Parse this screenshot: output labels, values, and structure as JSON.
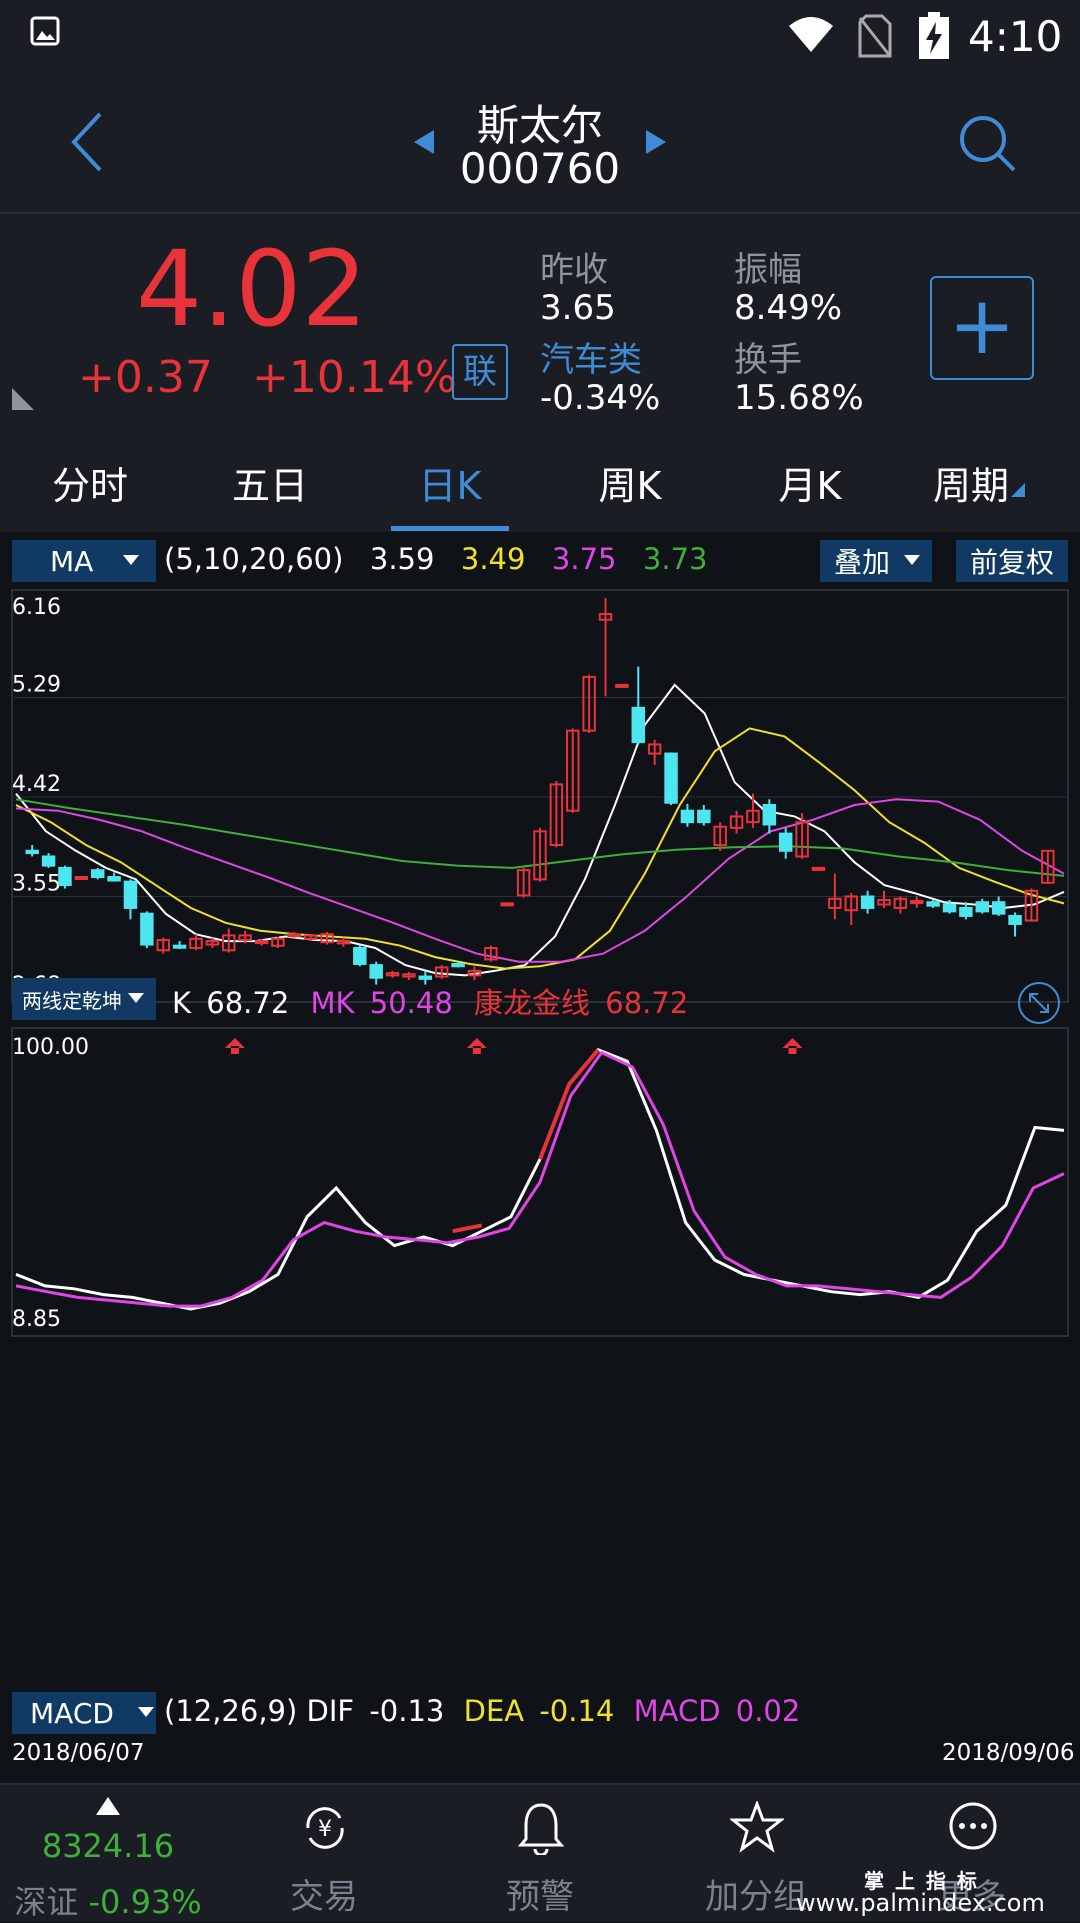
{
  "status": {
    "time": "4:10"
  },
  "header": {
    "name": "斯太尔",
    "code": "000760"
  },
  "quote": {
    "price": "4.02",
    "change": "+0.37",
    "change_pct": "+10.14%",
    "lian_badge": "联",
    "prev_close_label": "昨收",
    "prev_close": "3.65",
    "amplitude_label": "振幅",
    "amplitude": "8.49%",
    "sector_label": "汽车类",
    "sector_change": "-0.34%",
    "turnover_label": "换手",
    "turnover": "15.68%",
    "add_button": "+"
  },
  "tabs": [
    "分时",
    "五日",
    "日K",
    "周K",
    "月K",
    "周期"
  ],
  "ma_bar": {
    "selector": "MA",
    "params": "(5,10,20,60)",
    "v1": "3.59",
    "v2": "3.49",
    "v3": "3.75",
    "v4": "3.73",
    "overlay": "叠加",
    "adjust": "前复权"
  },
  "indicator_bar": {
    "selector": "两线定乾坤",
    "k_label": "K",
    "k_value": "68.72",
    "mk_label": "MK",
    "mk_value": "50.48",
    "klgx_label": "康龙金线",
    "klgx_value": "68.72"
  },
  "macd_bar": {
    "selector": "MACD",
    "params": "(12,26,9)",
    "dif_label": "DIF",
    "dif": "-0.13",
    "dea_label": "DEA",
    "dea": "-0.14",
    "macd_label": "MACD",
    "macd": "0.02"
  },
  "dates": {
    "start": "2018/06/07",
    "end": "2018/09/06"
  },
  "nav": {
    "index_value": "8324.16",
    "index_name": "深证",
    "index_change": "-0.93%",
    "trade": "交易",
    "alert": "预警",
    "watch": "加分组",
    "more": "更多",
    "watermark": "掌 上 指 标",
    "watermark_url": "www.palmindex.com"
  },
  "colors": {
    "up": "#e8333a",
    "down": "#4de6f0",
    "accent": "#3f8bd6",
    "ma5": "#ffffff",
    "ma10": "#f0e12a",
    "ma20": "#e046e6",
    "ma60": "#3fae3a"
  },
  "chart_data": [
    {
      "type": "candlestick",
      "title": "",
      "ylim": [
        2.68,
        6.16
      ],
      "ytick_labels": [
        "6.16",
        "5.29",
        "4.42",
        "3.55",
        "2.68"
      ],
      "ohlc": [
        [
          3.95,
          4.0,
          3.9,
          3.93
        ],
        [
          3.9,
          3.93,
          3.8,
          3.82
        ],
        [
          3.8,
          3.82,
          3.62,
          3.65
        ],
        [
          3.72,
          3.73,
          3.72,
          3.72
        ],
        [
          3.78,
          3.8,
          3.7,
          3.72
        ],
        [
          3.72,
          3.76,
          3.68,
          3.69
        ],
        [
          3.68,
          3.7,
          3.35,
          3.45
        ],
        [
          3.4,
          3.42,
          3.1,
          3.13
        ],
        [
          3.08,
          3.19,
          3.05,
          3.17
        ],
        [
          3.12,
          3.16,
          3.09,
          3.11
        ],
        [
          3.1,
          3.22,
          3.08,
          3.18
        ],
        [
          3.13,
          3.19,
          3.1,
          3.16
        ],
        [
          3.08,
          3.27,
          3.06,
          3.21
        ],
        [
          3.17,
          3.25,
          3.14,
          3.21
        ],
        [
          3.15,
          3.18,
          3.12,
          3.16
        ],
        [
          3.12,
          3.2,
          3.1,
          3.18
        ],
        [
          3.21,
          3.24,
          3.19,
          3.22
        ],
        [
          3.18,
          3.22,
          3.16,
          3.21
        ],
        [
          3.15,
          3.24,
          3.13,
          3.22
        ],
        [
          3.14,
          3.19,
          3.11,
          3.16
        ],
        [
          3.1,
          3.13,
          2.94,
          2.96
        ],
        [
          2.95,
          2.98,
          2.78,
          2.84
        ],
        [
          2.86,
          2.9,
          2.84,
          2.88
        ],
        [
          2.85,
          2.89,
          2.82,
          2.87
        ],
        [
          2.85,
          2.9,
          2.78,
          2.83
        ],
        [
          2.85,
          2.95,
          2.83,
          2.93
        ],
        [
          2.96,
          2.98,
          2.93,
          2.94
        ],
        [
          2.86,
          2.94,
          2.82,
          2.9
        ],
        [
          3.0,
          3.12,
          2.98,
          3.1
        ],
        [
          3.48,
          3.5,
          3.48,
          3.49
        ],
        [
          3.56,
          3.8,
          3.54,
          3.78
        ],
        [
          3.7,
          4.15,
          3.68,
          4.12
        ],
        [
          4.0,
          4.56,
          3.98,
          4.53
        ],
        [
          4.3,
          5.02,
          4.28,
          5.0
        ],
        [
          5.0,
          5.49,
          4.98,
          5.47
        ],
        [
          5.97,
          6.16,
          5.3,
          6.02
        ],
        [
          5.4,
          5.4,
          5.39,
          5.4
        ],
        [
          5.2,
          5.56,
          4.88,
          4.9
        ],
        [
          4.8,
          4.92,
          4.7,
          4.88
        ],
        [
          4.8,
          4.81,
          4.35,
          4.37
        ],
        [
          4.3,
          4.36,
          4.16,
          4.2
        ],
        [
          4.3,
          4.35,
          4.17,
          4.2
        ],
        [
          4.0,
          4.2,
          3.95,
          4.16
        ],
        [
          4.15,
          4.3,
          4.1,
          4.25
        ],
        [
          4.2,
          4.45,
          4.15,
          4.3
        ],
        [
          4.35,
          4.4,
          4.1,
          4.18
        ],
        [
          4.1,
          4.15,
          3.88,
          3.95
        ],
        [
          3.9,
          4.28,
          3.88,
          4.2
        ],
        [
          3.8,
          3.8,
          3.8,
          3.8
        ],
        [
          3.45,
          3.75,
          3.35,
          3.53
        ],
        [
          3.43,
          3.58,
          3.3,
          3.55
        ],
        [
          3.55,
          3.6,
          3.4,
          3.45
        ],
        [
          3.48,
          3.6,
          3.45,
          3.52
        ],
        [
          3.45,
          3.55,
          3.4,
          3.53
        ],
        [
          3.5,
          3.55,
          3.45,
          3.51
        ],
        [
          3.5,
          3.52,
          3.45,
          3.47
        ],
        [
          3.48,
          3.52,
          3.4,
          3.42
        ],
        [
          3.45,
          3.5,
          3.35,
          3.38
        ],
        [
          3.5,
          3.53,
          3.4,
          3.42
        ],
        [
          3.5,
          3.55,
          3.38,
          3.4
        ],
        [
          3.38,
          3.41,
          3.2,
          3.31
        ],
        [
          3.34,
          3.62,
          3.33,
          3.6
        ],
        [
          3.67,
          3.95,
          3.66,
          3.95
        ]
      ],
      "series": [
        {
          "name": "MA5",
          "values": [
            4.45,
            4.12,
            3.95,
            3.8,
            3.7,
            3.4,
            3.22,
            3.16,
            3.16,
            3.2,
            3.17,
            3.16,
            3.1,
            2.95,
            2.88,
            2.86,
            2.9,
            2.95,
            3.2,
            3.7,
            4.35,
            5.05,
            5.4,
            5.15,
            4.55,
            4.3,
            4.25,
            4.12,
            3.85,
            3.65,
            3.58,
            3.5,
            3.48,
            3.45,
            3.48,
            3.59
          ]
        },
        {
          "name": "MA10",
          "values": [
            4.35,
            4.2,
            4.0,
            3.85,
            3.65,
            3.45,
            3.32,
            3.25,
            3.22,
            3.2,
            3.18,
            3.12,
            3.02,
            2.96,
            2.92,
            2.94,
            3.0,
            3.25,
            3.75,
            4.35,
            4.82,
            5.02,
            4.95,
            4.72,
            4.48,
            4.2,
            4.02,
            3.8,
            3.68,
            3.57,
            3.49
          ]
        },
        {
          "name": "MA20",
          "values": [
            4.32,
            4.3,
            4.22,
            4.12,
            3.98,
            3.85,
            3.72,
            3.58,
            3.45,
            3.32,
            3.18,
            3.05,
            2.98,
            2.98,
            3.05,
            3.25,
            3.55,
            3.88,
            4.12,
            4.22,
            4.35,
            4.4,
            4.38,
            4.22,
            3.95,
            3.75
          ]
        },
        {
          "name": "MA60",
          "values": [
            4.4,
            4.32,
            4.25,
            4.18,
            4.1,
            4.02,
            3.94,
            3.86,
            3.82,
            3.8,
            3.86,
            3.92,
            3.96,
            3.98,
            3.99,
            3.97,
            3.9,
            3.85,
            3.78,
            3.73
          ]
        }
      ]
    },
    {
      "type": "line",
      "title": "",
      "ylim": [
        8.85,
        100.0
      ],
      "ytick_labels": [
        "100.00",
        "8.85"
      ],
      "series": [
        {
          "name": "K",
          "values": [
            20,
            16,
            15,
            13,
            12,
            10,
            8,
            10,
            14,
            20,
            40,
            50,
            38,
            30,
            33,
            30,
            35,
            40,
            60,
            86,
            98,
            94,
            70,
            38,
            25,
            20,
            18,
            16,
            14,
            13,
            14,
            12,
            18,
            35,
            44,
            71,
            70
          ]
        },
        {
          "name": "MK",
          "values": [
            16,
            14,
            12,
            11,
            10,
            9,
            9,
            12,
            18,
            32,
            38,
            35,
            33,
            32,
            31,
            33,
            36,
            52,
            82,
            97,
            92,
            72,
            42,
            26,
            20,
            16,
            16,
            15,
            14,
            13,
            12,
            19,
            30,
            50,
            55
          ]
        },
        {
          "name": "康龙金线",
          "values": [
            null,
            null,
            null,
            null,
            null,
            null,
            null,
            null,
            null,
            null,
            null,
            null,
            null,
            null,
            null,
            35,
            37,
            null,
            60,
            86,
            98,
            null,
            null,
            null,
            null,
            null,
            null,
            null,
            null,
            null,
            null,
            null,
            null,
            null,
            null,
            null,
            null
          ]
        }
      ]
    }
  ]
}
